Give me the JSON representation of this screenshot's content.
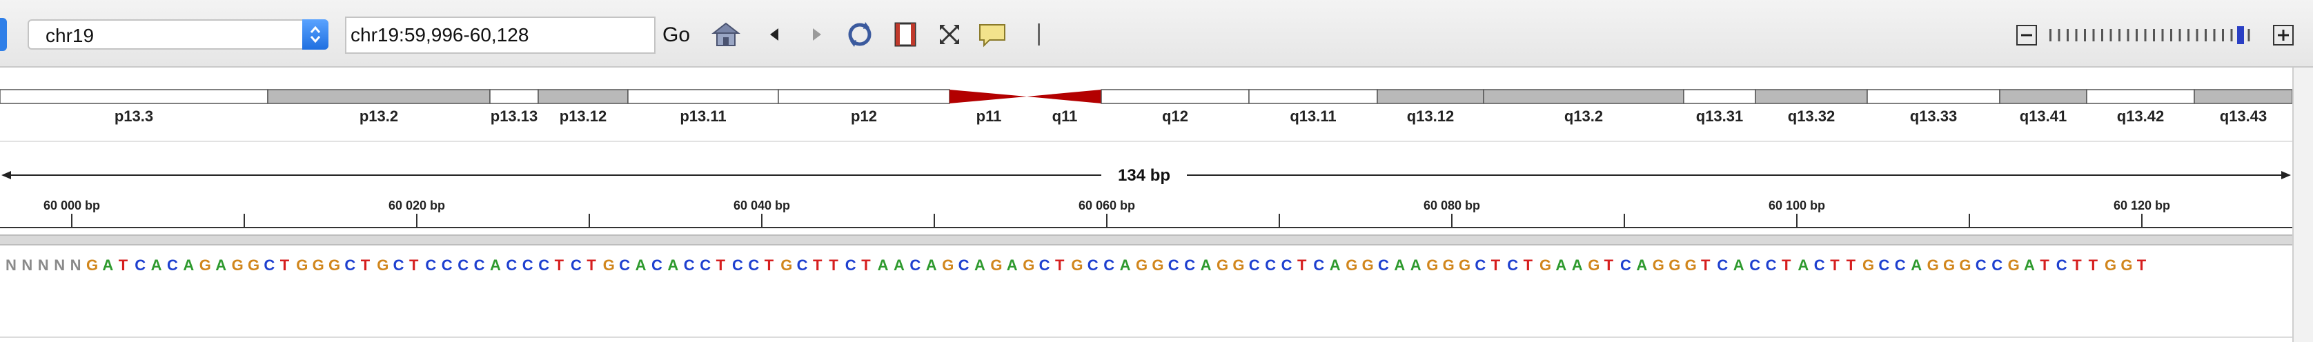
{
  "toolbar": {
    "chromosome": "chr19",
    "locus": "chr19:59,996-60,128",
    "go_label": "Go",
    "icons": [
      "home-icon",
      "back-icon",
      "forward-icon",
      "refresh-icon",
      "roi-icon",
      "fit-icon",
      "popup-info-icon",
      "zoom-out-icon",
      "zoom-in-icon"
    ]
  },
  "ideogram": {
    "bands": [
      {
        "name": "p13.3",
        "shade": "white"
      },
      {
        "name": "p13.2",
        "shade": "gray"
      },
      {
        "name": "p13.13",
        "shade": "white"
      },
      {
        "name": "p13.12",
        "shade": "gray"
      },
      {
        "name": "p13.11",
        "shade": "white"
      },
      {
        "name": "p12",
        "shade": "white"
      },
      {
        "name": "p11",
        "shade": "centromere"
      },
      {
        "name": "q11",
        "shade": "centromere"
      },
      {
        "name": "q12",
        "shade": "white"
      },
      {
        "name": "q13.11",
        "shade": "white"
      },
      {
        "name": "q13.12",
        "shade": "gray"
      },
      {
        "name": "q13.2",
        "shade": "gray"
      },
      {
        "name": "q13.31",
        "shade": "white"
      },
      {
        "name": "q13.32",
        "shade": "gray"
      },
      {
        "name": "q13.33",
        "shade": "white"
      },
      {
        "name": "q13.41",
        "shade": "gray"
      },
      {
        "name": "q13.42",
        "shade": "white"
      },
      {
        "name": "q13.43",
        "shade": "gray"
      }
    ],
    "colors": {
      "gray": "#b9b9b9",
      "white": "#ffffff",
      "centromere": "#b30000"
    }
  },
  "ruler": {
    "span_label": "134 bp",
    "tick_labels": [
      "60 000 bp",
      "60 020 bp",
      "60 040 bp",
      "60 060 bp",
      "60 080 bp",
      "60 100 bp",
      "60 120 bp"
    ]
  },
  "sequence": {
    "bases": "NNNNNGATCACAGAGGCTGGGCTGCTCCCCACCCTCTGCACACCTCCTGCTTCTAACAGCAGAGCTGCCAGGCCAGGCCCTCAGGCAAGGGCTCTGAAGTCAGGGTCACCTACTTGCCAGGGCCGATCTTGGT",
    "colors": {
      "A": "#2e9a2e",
      "C": "#1d3fcf",
      "G": "#d1861c",
      "T": "#d61e1e",
      "N": "#8a8a8a"
    }
  }
}
